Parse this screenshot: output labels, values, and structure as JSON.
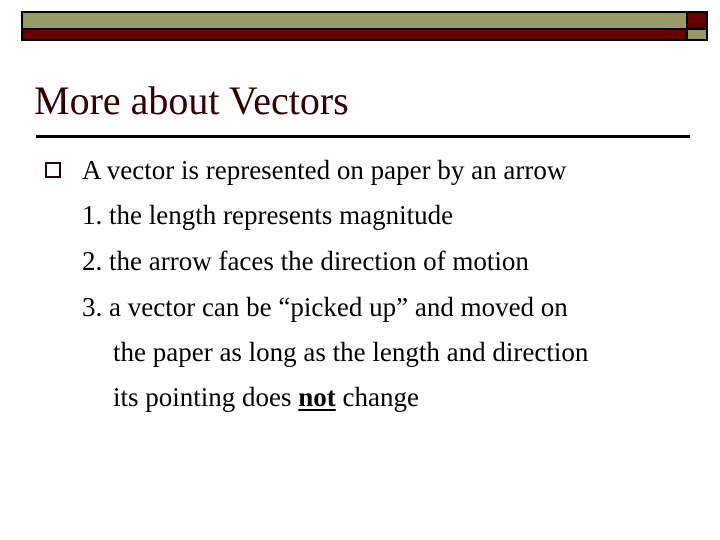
{
  "slide": {
    "title": "More about Vectors",
    "colors": {
      "band_olive": "#999966",
      "band_red": "#660000",
      "title": "#330000",
      "text": "#000000",
      "bullet": "#330000"
    },
    "bullet_icon": "hollow-square-icon",
    "body": {
      "intro": "A vector is represented on paper by an arrow",
      "items": [
        {
          "text": "1. the length represents magnitude"
        },
        {
          "text": "2. the arrow faces the direction of motion"
        },
        {
          "first_line": "3. a vector can be “picked up” and moved on",
          "second_line": "the paper as long as the length and direction",
          "third_line_before": "its pointing does ",
          "third_line_emphasis": "not",
          "third_line_after": " change"
        }
      ]
    }
  }
}
